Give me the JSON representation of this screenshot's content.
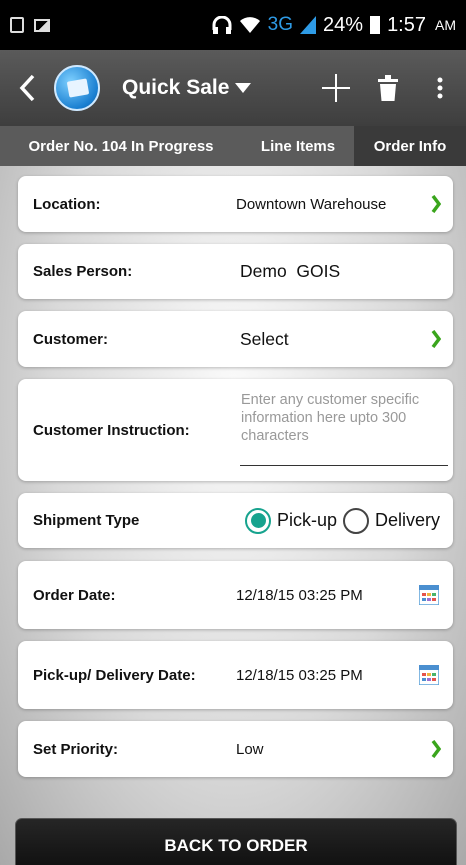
{
  "status_bar": {
    "time": "1:57",
    "ampm": "AM",
    "battery": "24%",
    "network": "3G"
  },
  "app_bar": {
    "title": "Quick Sale"
  },
  "tabs": [
    {
      "label": "Order No. 104 In Progress"
    },
    {
      "label": "Line Items"
    },
    {
      "label": "Order Info"
    }
  ],
  "form": {
    "location": {
      "label": "Location:",
      "value": "Downtown Warehouse"
    },
    "sales_person": {
      "label": "Sales Person:",
      "value": "Demo  GOIS"
    },
    "customer": {
      "label": "Customer:",
      "value": "Select"
    },
    "customer_instruction": {
      "label": "Customer Instruction:",
      "placeholder": "Enter any customer specific information here upto 300 characters"
    },
    "shipment_type": {
      "label": "Shipment Type",
      "options": [
        "Pick-up",
        "Delivery"
      ],
      "selected": "Pick-up"
    },
    "order_date": {
      "label": "Order Date:",
      "value": "12/18/15 03:25 PM"
    },
    "pickup_delivery_date": {
      "label": "Pick-up/ Delivery Date:",
      "value": "12/18/15 03:25 PM"
    },
    "priority": {
      "label": "Set Priority:",
      "value": "Low"
    }
  },
  "actions": {
    "back_to_order": "BACK TO ORDER"
  },
  "colors": {
    "accent": "#17a38e",
    "chevron": "#3aa51c",
    "appbar": "#4a4a4a"
  }
}
